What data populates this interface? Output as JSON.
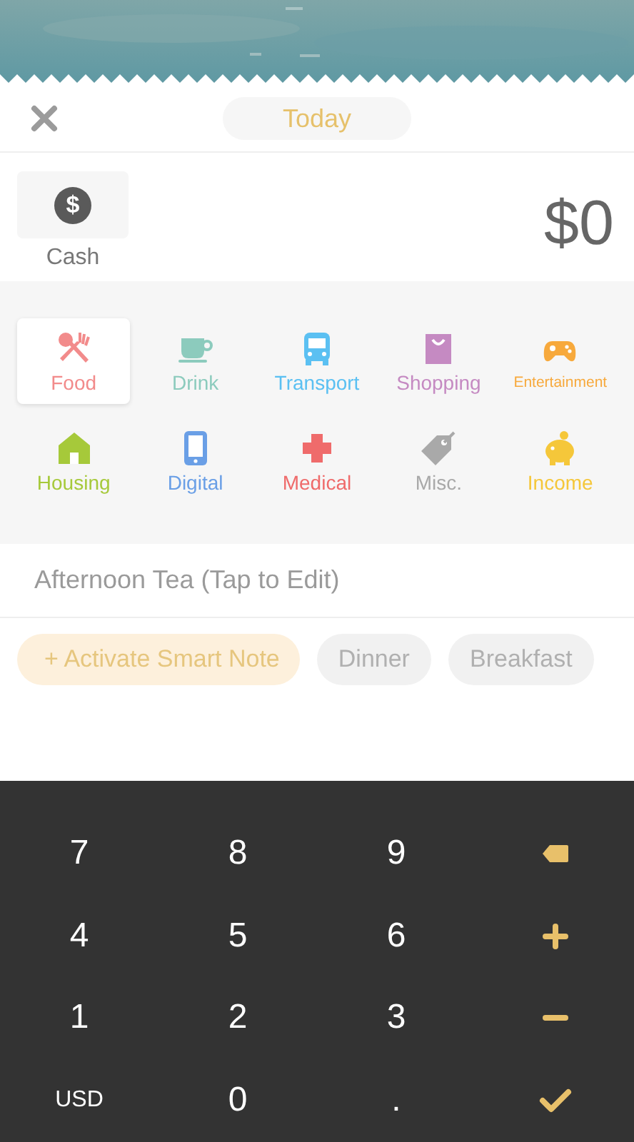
{
  "header": {
    "date": "Today"
  },
  "account": {
    "icon": "$",
    "name": "Cash",
    "amount": "$0"
  },
  "categories": [
    {
      "label": "Food",
      "color": "#f28b8b",
      "selected": true
    },
    {
      "label": "Drink",
      "color": "#8ccbbd",
      "selected": false
    },
    {
      "label": "Transport",
      "color": "#5bc0f2",
      "selected": false
    },
    {
      "label": "Shopping",
      "color": "#c58ac2",
      "selected": false
    },
    {
      "label": "Entertainment",
      "color": "#f7a93c",
      "selected": false
    },
    {
      "label": "Housing",
      "color": "#a6c93a",
      "selected": false
    },
    {
      "label": "Digital",
      "color": "#6a9fe6",
      "selected": false
    },
    {
      "label": "Medical",
      "color": "#ef6b6b",
      "selected": false
    },
    {
      "label": "Misc.",
      "color": "#a9a9a9",
      "selected": false
    },
    {
      "label": "Income",
      "color": "#f5c73a",
      "selected": false
    }
  ],
  "note": {
    "placeholder": "Afternoon Tea (Tap to Edit)"
  },
  "chips": [
    {
      "label": "+ Activate Smart Note",
      "kind": "action"
    },
    {
      "label": "Dinner",
      "kind": "suggestion"
    },
    {
      "label": "Breakfast",
      "kind": "suggestion"
    }
  ],
  "keypad": [
    {
      "kind": "digit",
      "label": "7"
    },
    {
      "kind": "digit",
      "label": "8"
    },
    {
      "kind": "digit",
      "label": "9"
    },
    {
      "kind": "backspace"
    },
    {
      "kind": "digit",
      "label": "4"
    },
    {
      "kind": "digit",
      "label": "5"
    },
    {
      "kind": "digit",
      "label": "6"
    },
    {
      "kind": "plus"
    },
    {
      "kind": "digit",
      "label": "1"
    },
    {
      "kind": "digit",
      "label": "2"
    },
    {
      "kind": "digit",
      "label": "3"
    },
    {
      "kind": "minus"
    },
    {
      "kind": "currency",
      "label": "USD"
    },
    {
      "kind": "digit",
      "label": "0"
    },
    {
      "kind": "digit",
      "label": "."
    },
    {
      "kind": "confirm"
    }
  ]
}
